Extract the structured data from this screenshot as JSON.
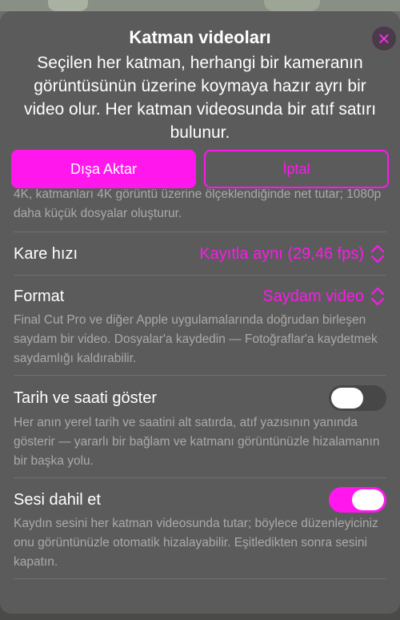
{
  "dialog": {
    "title": "Katman videoları",
    "subtitle": "Seçilen her katman, herhangi bir kameranın görüntüsünün üzerine koymaya hazır ayrı bir video olur. Her katman videosunda bir atıf satırı bulunur.",
    "close_icon": "×"
  },
  "actions": {
    "export_label": "Dışa Aktar",
    "cancel_label": "İptal"
  },
  "resolution": {
    "desc_clipped": "4K, katmanları 4K görüntü üzerine ölçeklendiğinde net tutar; 1080p daha küçük dosyalar oluşturur."
  },
  "frame_rate": {
    "label": "Kare hızı",
    "value": "Kayıtla aynı (29,46 fps)"
  },
  "format": {
    "label": "Format",
    "value": "Saydam video",
    "desc": "Final Cut Pro ve diğer Apple uygulamalarında doğrudan birleşen saydam bir video. Dosyalar'a kaydedin — Fotoğraflar'a kaydetmek saydamlığı kaldırabilir."
  },
  "datetime": {
    "label": "Tarih ve saati göster",
    "enabled": false,
    "desc": "Her anın yerel tarih ve saatini alt satırda, atıf yazısının yanında gösterir — yararlı bir bağlam ve katmanı görüntünüzle hizalamanın bir başka yolu."
  },
  "audio": {
    "label": "Sesi dahil et",
    "enabled": true,
    "desc": "Kaydın sesini her katman videosunda tutar; böylece düzenleyiciniz onu görüntünüzle otomatik hizalayabilir. Eşitledikten sonra sesini kapatın."
  },
  "colors": {
    "accent": "#ff17ee",
    "sheet_bg": "#5b5b5b",
    "secondary_text": "#aaaaaa"
  }
}
